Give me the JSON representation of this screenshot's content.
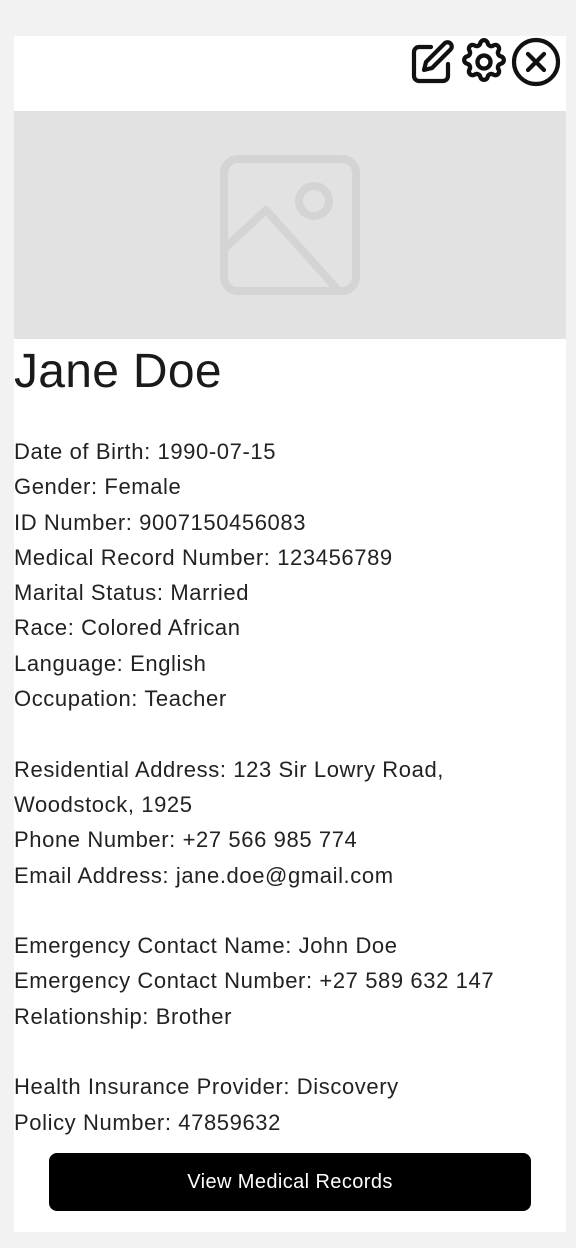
{
  "toolbar": {
    "icons": [
      "edit-icon",
      "gear-icon",
      "close-icon"
    ]
  },
  "profile": {
    "photo_icon": "image-placeholder-icon",
    "name": "Jane Doe",
    "date_of_birth": "Date of Birth: 1990-07-15",
    "gender": "Gender: Female",
    "id_number": "ID Number: 9007150456083",
    "medical_record_number": "Medical Record Number: 123456789",
    "marital_status": "Marital Status: Married",
    "race": "Race: Colored African",
    "language": "Language: English",
    "occupation": "Occupation: Teacher"
  },
  "contact": {
    "residential_address": "Residential Address: 123 Sir Lowry Road, Woodstock, 1925",
    "phone_number": "Phone Number: +27 566 985 774",
    "email_address": "Email Address: jane.doe@gmail.com"
  },
  "emergency": {
    "contact_name": "Emergency Contact Name: John Doe",
    "contact_number": "Emergency Contact Number: +27 589 632 147",
    "relationship": "Relationship: Brother"
  },
  "insurance": {
    "provider": "Health Insurance Provider: Discovery",
    "policy_number": "Policy Number: 47859632"
  },
  "actions": {
    "view_records_label": "View Medical Records"
  },
  "colors": {
    "page_background": "#f2f2f2",
    "card_background": "#ffffff",
    "photo_placeholder": "#e2e2e2",
    "button_background": "#000000",
    "button_text": "#ffffff"
  }
}
